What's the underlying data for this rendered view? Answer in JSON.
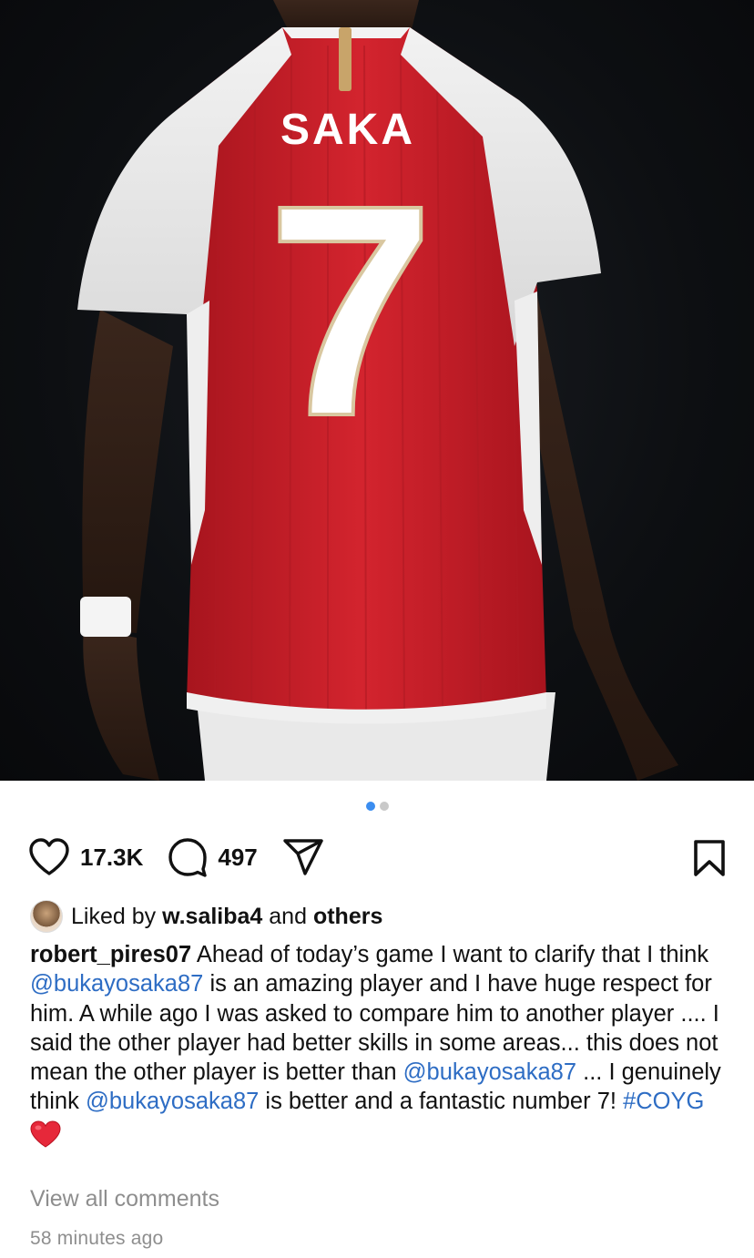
{
  "post": {
    "jersey_name": "SAKA",
    "jersey_number": "7",
    "carousel": {
      "count": 2,
      "active": 1
    }
  },
  "actions": {
    "like_icon": "heart-icon",
    "like_count": "17.3K",
    "comment_icon": "comment-icon",
    "comment_count": "497",
    "share_icon": "send-icon",
    "save_icon": "bookmark-icon"
  },
  "likes": {
    "prefix": "Liked by",
    "user": "w.saliba4",
    "middle": "and",
    "others": "others"
  },
  "caption": {
    "username": "robert_pires07",
    "text1": "Ahead of today’s game I want to clarify that I think",
    "mention1": "@bukayosaka87",
    "text2": "is an amazing player and I have huge respect for him. A while ago I was asked to compare him to another player .... I said the other player had better skills in some areas... this does not mean the other player is better than",
    "mention2": "@bukayosaka87",
    "text3": "... I genuinely think",
    "mention3": "@bukayosaka87",
    "text4": "is better and a fantastic number 7!",
    "hashtag": "#COYG",
    "emoji": "red-heart-emoji"
  },
  "footer": {
    "view_all": "View all comments",
    "timestamp": "58 minutes ago"
  },
  "colors": {
    "link": "#2e6dc4",
    "carousel_active": "#3b8df0",
    "muted": "#8e8e8e",
    "jersey_red": "#c8202a"
  }
}
